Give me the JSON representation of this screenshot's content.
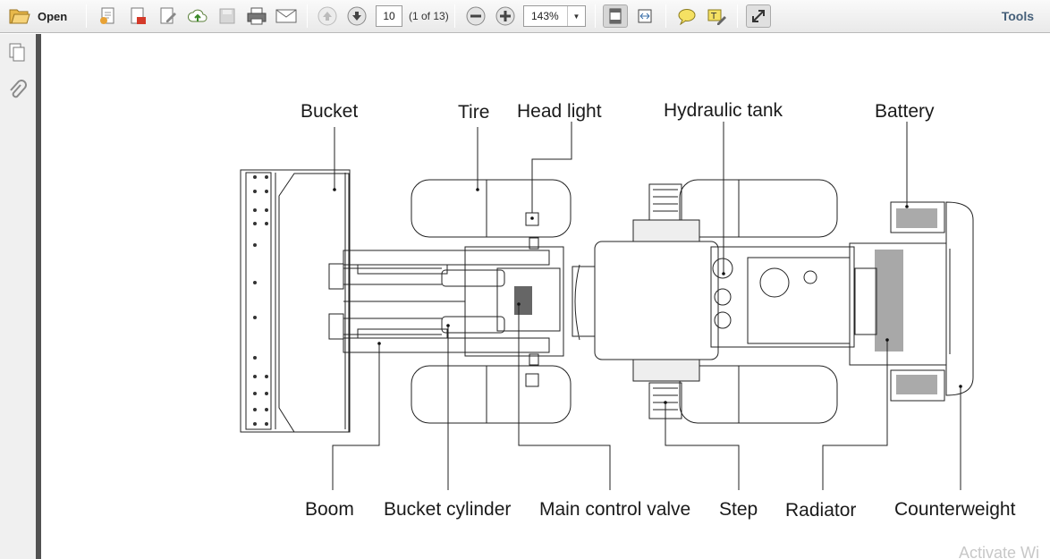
{
  "toolbar": {
    "open_label": "Open",
    "page_current": "10",
    "page_count": "(1 of 13)",
    "zoom_value": "143%",
    "tools_label": "Tools",
    "icons": [
      "folder-open-icon",
      "create-pdf-icon",
      "export-pdf-icon",
      "edit-pdf-icon",
      "upload-cloud-icon",
      "save-icon",
      "print-icon",
      "email-icon",
      "page-up-icon",
      "page-down-icon",
      "zoom-out-icon",
      "zoom-in-icon",
      "fit-page-icon",
      "fit-width-icon",
      "comment-icon",
      "highlight-icon",
      "fullscreen-icon"
    ]
  },
  "sidebar": {
    "icons": [
      "pages-icon",
      "attachment-icon"
    ]
  },
  "diagram": {
    "labels": {
      "bucket": "Bucket",
      "tire": "Tire",
      "head_light": "Head light",
      "hydraulic_tank": "Hydraulic tank",
      "battery": "Battery",
      "boom": "Boom",
      "bucket_cylinder": "Bucket cylinder",
      "main_control_valve": "Main control valve",
      "step": "Step",
      "radiator": "Radiator",
      "counterweight": "Counterweight"
    }
  },
  "watermark": "Activate Wi"
}
